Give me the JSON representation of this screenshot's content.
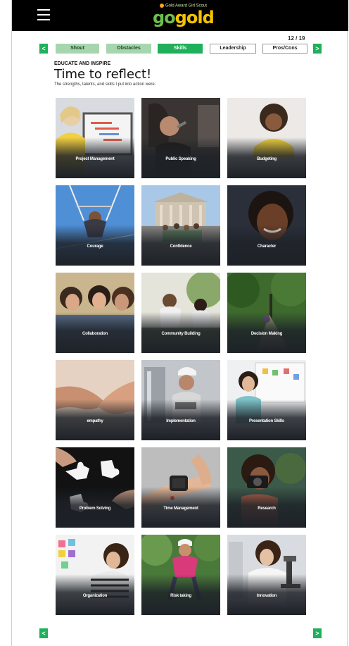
{
  "header": {
    "menu_icon": "hamburger-menu-icon",
    "logo_tagline": "Gold Award Girl Scout",
    "logo_go": "go",
    "logo_gold": "gold",
    "colors": {
      "bar": "#000000",
      "logo_green": "#6cc04a",
      "logo_gold": "#f2c300"
    }
  },
  "progress": {
    "counter": "12 / 19",
    "current_page": 12,
    "total_pages": 19
  },
  "nav": {
    "prev_symbol": "<",
    "next_symbol": ">",
    "accent": "#1eb05a",
    "tabs": [
      {
        "label": "Shout",
        "state": "light"
      },
      {
        "label": "Obstacles",
        "state": "light"
      },
      {
        "label": "Skills",
        "state": "active"
      },
      {
        "label": "Leadership",
        "state": "plain"
      },
      {
        "label": "Pros/Cons",
        "state": "plain"
      }
    ]
  },
  "intro": {
    "eyebrow": "EDUCATE AND INSPIRE",
    "title": "Time to reflect!",
    "subtitle": "The strengths, talents, and skills I put into action were:"
  },
  "skills": [
    {
      "label": "Project Management",
      "photo": "woman-at-laptop-gantt-chart"
    },
    {
      "label": "Public Speaking",
      "photo": "woman-speaking-into-microphone"
    },
    {
      "label": "Budgeting",
      "photo": "woman-in-yellow-on-couch"
    },
    {
      "label": "Courage",
      "photo": "girl-on-trapeze"
    },
    {
      "label": "Confidence",
      "photo": "group-in-front-of-museum"
    },
    {
      "label": "Character",
      "photo": "smiling-girl-portrait"
    },
    {
      "label": "Collaboration",
      "photo": "girls-talking-together"
    },
    {
      "label": "Community Building",
      "photo": "girls-planting-outdoors"
    },
    {
      "label": "Decision Making",
      "photo": "path-through-forest"
    },
    {
      "label": "empathy",
      "photo": "holding-hands"
    },
    {
      "label": "Implementation",
      "photo": "woman-in-hard-hat-on-phone"
    },
    {
      "label": "Presentation Skills",
      "photo": "woman-at-whiteboard"
    },
    {
      "label": "Problem Solving",
      "photo": "hands-with-puzzle-pieces"
    },
    {
      "label": "Time Management",
      "photo": "smartwatch-on-wrist"
    },
    {
      "label": "Research",
      "photo": "girl-with-camera"
    },
    {
      "label": "Organization",
      "photo": "girl-with-sticky-notes"
    },
    {
      "label": "Risk taking",
      "photo": "girl-climbing-with-helmet"
    },
    {
      "label": "Innovation",
      "photo": "scientist-at-microscope"
    }
  ]
}
